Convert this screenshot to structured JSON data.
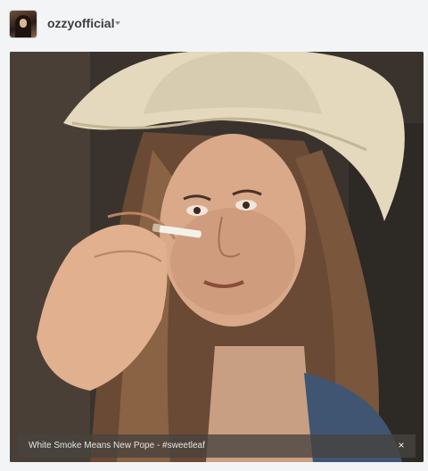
{
  "header": {
    "username": "ozzyofficial"
  },
  "icons": {
    "dropdown": "chevron-down-icon",
    "close": "close-icon"
  },
  "photo": {
    "caption": "White Smoke Means New Pope - #sweetleaf",
    "close_label": "×"
  },
  "colors": {
    "background": "#f3f4f6",
    "username": "#3d3d3d",
    "caption_bar": "#46423e"
  }
}
